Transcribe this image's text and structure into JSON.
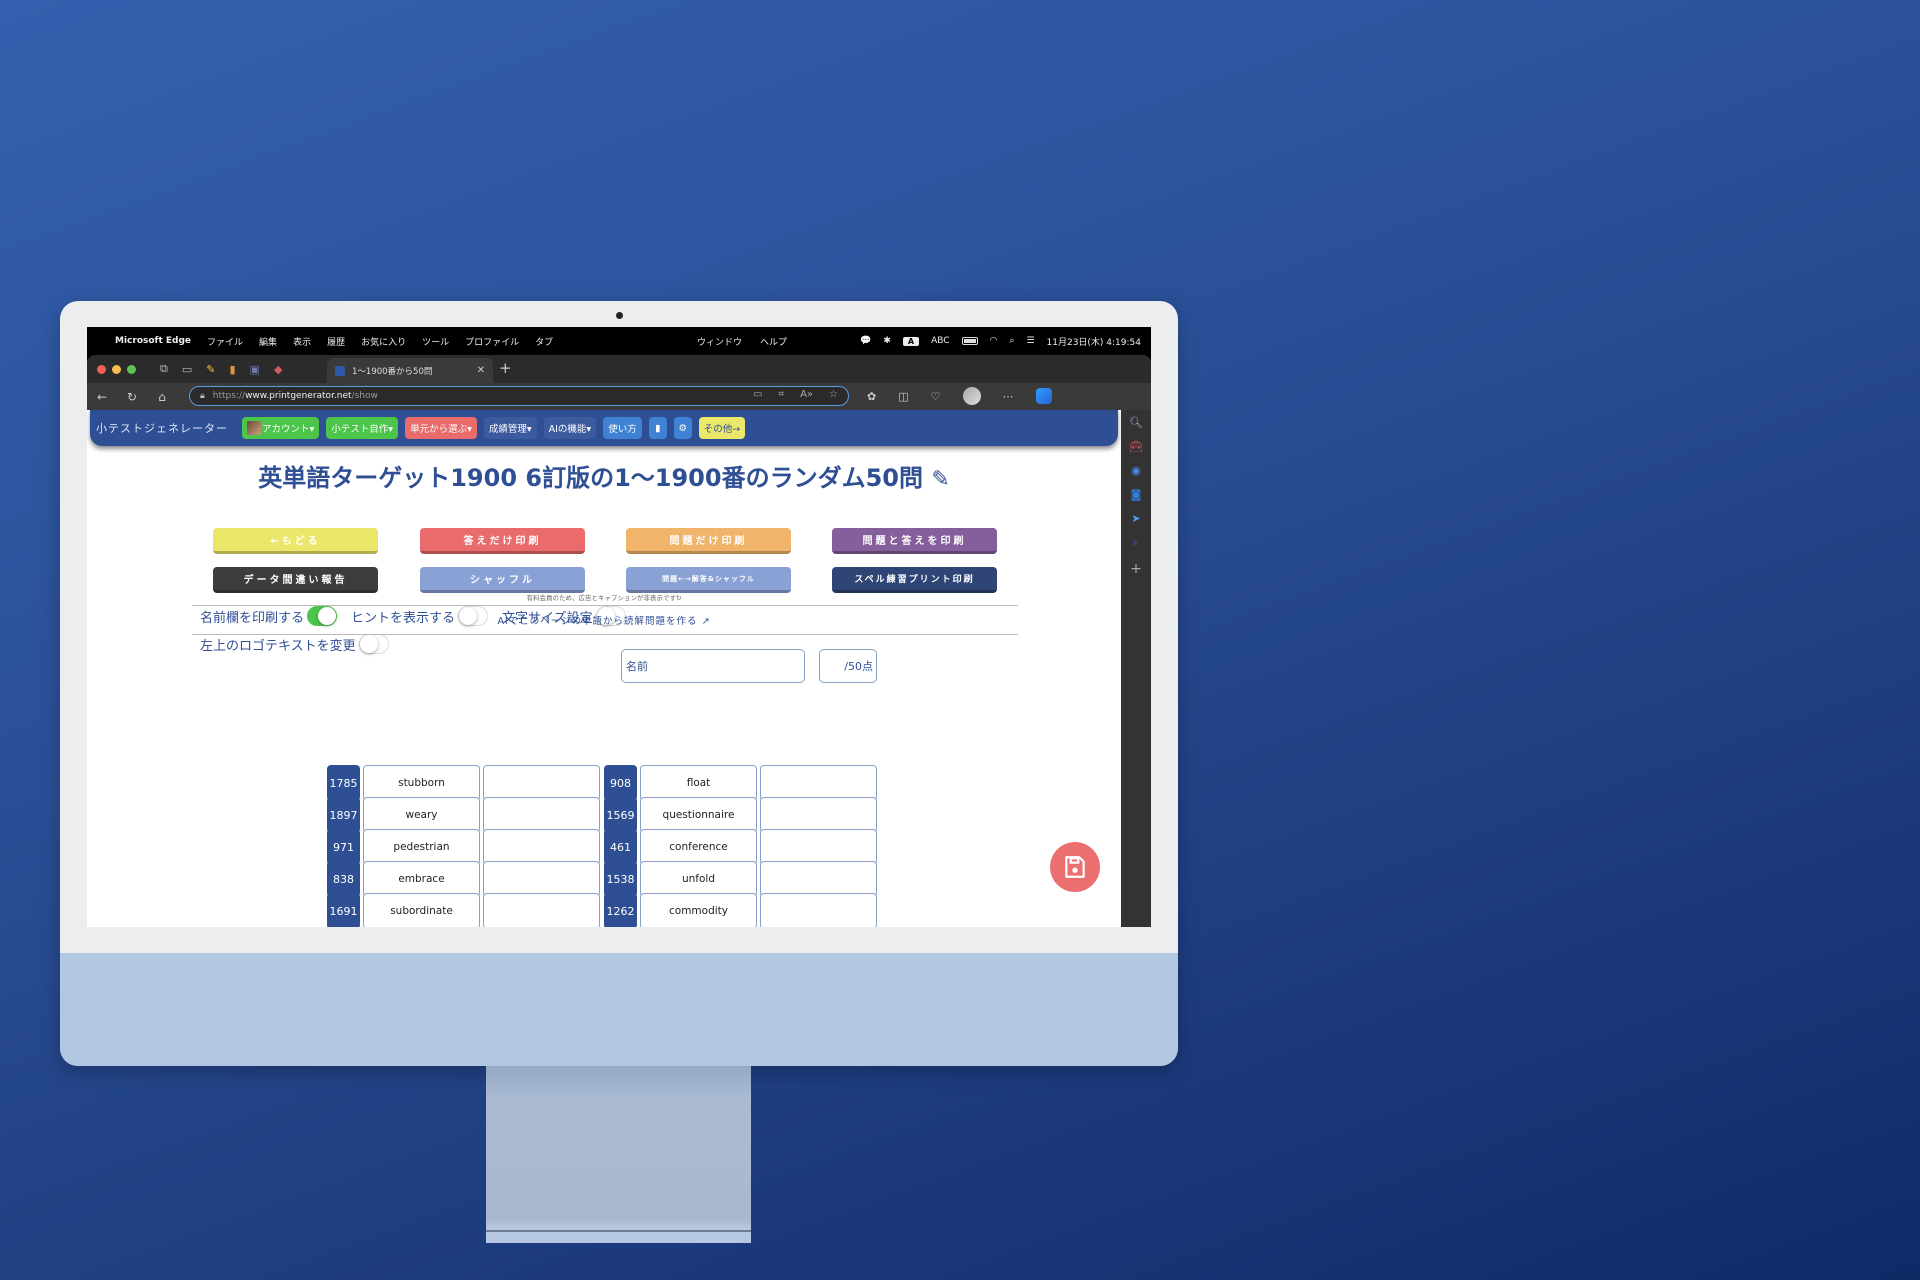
{
  "menubar": {
    "app_name": "Microsoft Edge",
    "menus": [
      "ファイル",
      "編集",
      "表示",
      "履歴",
      "お気に入り",
      "ツール",
      "プロファイル",
      "タブ"
    ],
    "menus_center": [
      "ウィンドウ",
      "ヘルプ"
    ],
    "input_mode": "A",
    "input_label": "ABC",
    "datetime": "11月23日(木) 4:19:54"
  },
  "browser": {
    "active_tab_title": "1〜1900番から50問",
    "url_scheme": "https://",
    "url_host": "www.printgenerator.net",
    "url_path": "/show"
  },
  "appnav": {
    "brand": "小テストジェネレーター",
    "items": [
      {
        "label": "アカウント▾",
        "color": "#4cc54b"
      },
      {
        "label": "小テスト自作▾",
        "color": "#4cc54b"
      },
      {
        "label": "単元から選ぶ▾",
        "color": "#e96b6b"
      },
      {
        "label": "成績管理▾",
        "color": "#3c5a9e"
      },
      {
        "label": "AIの機能▾",
        "color": "#3c5a9e"
      },
      {
        "label": "使い方",
        "color": "#3f82d4"
      },
      {
        "label": "🔖",
        "color": "#3f82d4"
      },
      {
        "label": "⚙",
        "color": "#3f82d4"
      },
      {
        "label": "その他→",
        "color": "#ece86a"
      }
    ]
  },
  "main": {
    "title": "英単語ターゲット1900 6訂版の1〜1900番のランダム50問",
    "buttons": [
      {
        "label": "←もどる",
        "color": "#ebe66a"
      },
      {
        "label": "答えだけ印刷",
        "color": "#e96b6b"
      },
      {
        "label": "問題だけ印刷",
        "color": "#f0b46a"
      },
      {
        "label": "問題と答えを印刷",
        "color": "#855e9c"
      },
      {
        "label": "データ間違い報告",
        "color": "#3d3d3d"
      },
      {
        "label": "シャッフル",
        "color": "#89a1d4"
      },
      {
        "label": "問題←→解答&シャッフル",
        "color": "#89a1d4"
      },
      {
        "label": "スペル練習プリント印刷",
        "color": "#2f4575"
      }
    ],
    "toggles": [
      {
        "label": "名前欄を印刷する",
        "on": true
      },
      {
        "label": "ヒントを表示する",
        "on": false
      },
      {
        "label": "文字サイズ設定",
        "on": false
      },
      {
        "label": "左上のロゴテキストを変更",
        "on": false
      }
    ],
    "notice": "有料会員のため、広告とキャプションが非表示です↻",
    "ai_link": "AIでこのページの単語から読解問題を作る",
    "name_field": "名前",
    "score_field": "/50点",
    "rows": [
      {
        "left_num": "1785",
        "left_word": "stubborn",
        "right_num": "908",
        "right_word": "float"
      },
      {
        "left_num": "1897",
        "left_word": "weary",
        "right_num": "1569",
        "right_word": "questionnaire"
      },
      {
        "left_num": "971",
        "left_word": "pedestrian",
        "right_num": "461",
        "right_word": "conference"
      },
      {
        "left_num": "838",
        "left_word": "embrace",
        "right_num": "1538",
        "right_word": "unfold"
      },
      {
        "left_num": "1691",
        "left_word": "subordinate",
        "right_num": "1262",
        "right_word": "commodity"
      }
    ]
  }
}
